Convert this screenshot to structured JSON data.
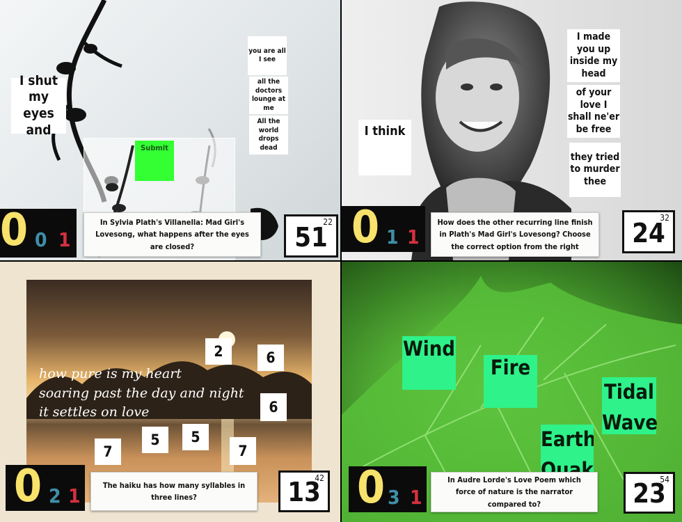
{
  "panels": [
    {
      "cards": [
        "I shut my eyes and",
        "you are all I see",
        "all the doctors lounge at me",
        "All the world drops dead"
      ],
      "submit_label": "Submit",
      "score": {
        "big": "0",
        "mid": "0",
        "small": "1"
      },
      "question": "In Sylvia Plath's Villanella: Mad Girl's Lovesong, what happens after the eyes are closed?",
      "timer": {
        "value": "51",
        "sub": "22"
      }
    },
    {
      "cards": [
        "I think",
        "I made you up inside my head",
        "of your love I shall ne'er be free",
        "they tried to murder thee"
      ],
      "score": {
        "big": "0",
        "mid": "1",
        "small": "1"
      },
      "question": "How does the other recurring line finish in Plath's Mad Girl's Lovesong? Choose the correct option from the right",
      "timer": {
        "value": "24",
        "sub": "32"
      }
    },
    {
      "poem": [
        "how pure is my heart",
        "soaring past the day and night",
        "it settles on love"
      ],
      "numbers": [
        "2",
        "6",
        "6",
        "7",
        "5",
        "5",
        "7"
      ],
      "score": {
        "big": "0",
        "mid": "2",
        "small": "1"
      },
      "question": "The haiku has how many syllables in three lines?",
      "timer": {
        "value": "13",
        "sub": "42"
      }
    },
    {
      "cards": [
        "Wind",
        "Fire",
        "Tidal Wave",
        "Earth Quake"
      ],
      "score": {
        "big": "0",
        "mid": "3",
        "small": "1"
      },
      "question": "In Audre Lorde's Love Poem which force of nature is the narrator compared to?",
      "timer": {
        "value": "23",
        "sub": "54"
      }
    }
  ],
  "colors": {
    "score_yellow": "#f7e26b",
    "score_teal": "#3e8fa8",
    "score_red": "#d6303f",
    "submit_green": "#33ff33",
    "option_green": "#2ff28a"
  }
}
